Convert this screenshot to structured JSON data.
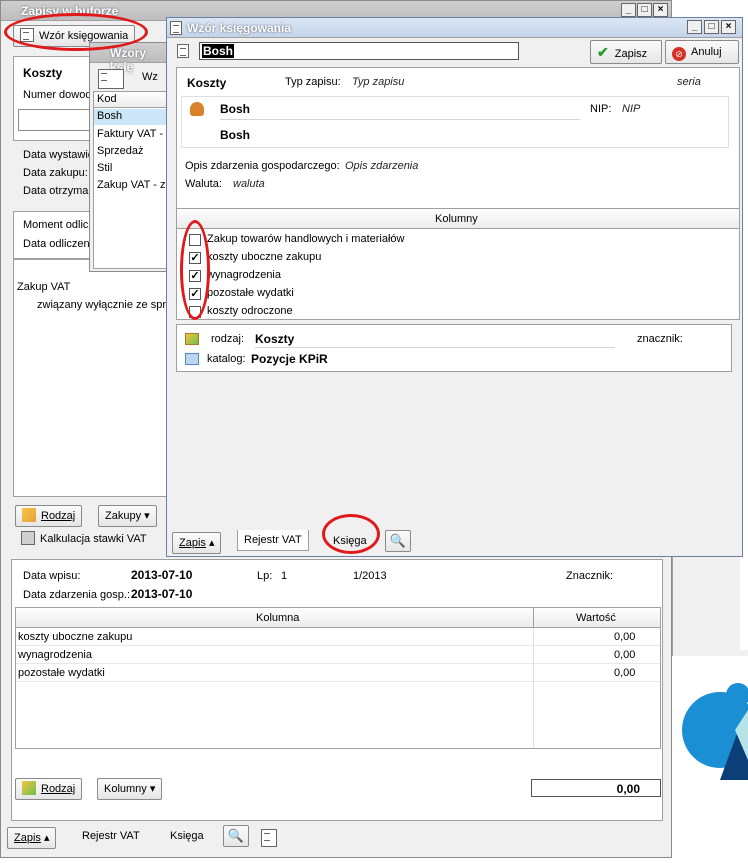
{
  "bg_window": {
    "title": "Zapisy w buforze",
    "tab_button": "Wzór księgowania",
    "label_koszty": "Koszty",
    "label_numer": "Numer dowod",
    "label_data_wystaw": "Data wystawie",
    "label_data_zakupu": "Data zakupu:",
    "label_data_otrzym": "Data otrzymar",
    "label_moment": "Moment odlicz",
    "label_data_odlicz": "Data odliczen",
    "zakup_vat": "Zakup VAT",
    "zwiazany": "związany wyłącznie ze spra",
    "btn_rodzaj": "Rodzaj",
    "btn_zakupy": "Zakupy",
    "btn_kalkulacja": "Kalkulacja stawki VAT",
    "label_data_wpisu": "Data wpisu:",
    "value_data_wpisu": "2013-07-10",
    "label_lp": "Lp:",
    "value_lp": "1",
    "value_lp_num": "1/2013",
    "label_znacznik": "Znacznik:",
    "label_data_zdarzenia": "Data zdarzenia gosp.:",
    "value_data_zdarzenia": "2013-07-10",
    "table_headers": [
      "Kolumna",
      "Wartość"
    ],
    "table_rows": [
      {
        "name": "koszty uboczne zakupu",
        "value": "0,00"
      },
      {
        "name": "wynagrodzenia",
        "value": "0,00"
      },
      {
        "name": "pozostałe wydatki",
        "value": "0,00"
      }
    ],
    "btn_rodzaj2": "Rodzaj",
    "btn_kolumny": "Kolumny",
    "total": "0,00",
    "tab_zapis": "Zapis",
    "tab_rejestr": "Rejestr VAT",
    "tab_ksiega": "Księga"
  },
  "wzory_window": {
    "title": "Wzory księ",
    "toolbar_label": "Wz",
    "col_kod": "Kod",
    "items": [
      "Bosh",
      "Faktury VAT -",
      "Sprzedaż",
      "Stil",
      "Zakup VAT - z"
    ]
  },
  "main_window": {
    "title": "Wzór księgowania",
    "name_value": "Bosh",
    "btn_zapisz": "Zapisz",
    "btn_anuluj": "Anuluj",
    "label_koszty": "Koszty",
    "label_typ_zapisu": "Typ zapisu:",
    "value_typ_zapisu": "Typ zapisu",
    "value_seria": "seria",
    "contractor_name1": "Bosh",
    "contractor_name2": "Bosh",
    "label_nip": "NIP:",
    "value_nip": "NIP",
    "label_opis": "Opis zdarzenia gospodarczego:",
    "value_opis": "Opis zdarzenia",
    "label_waluta": "Waluta:",
    "value_waluta": "waluta",
    "kolumny_header": "Kolumny",
    "checkboxes": [
      {
        "label": "Zakup towarów handlowych i materiałów",
        "checked": false
      },
      {
        "label": "koszty uboczne zakupu",
        "checked": true
      },
      {
        "label": "wynagrodzenia",
        "checked": true
      },
      {
        "label": "pozostałe wydatki",
        "checked": true
      },
      {
        "label": "koszty odroczone",
        "checked": false
      }
    ],
    "label_rodzaj": "rodzaj:",
    "value_rodzaj": "Koszty",
    "label_znacznik": "znacznik:",
    "label_katalog": "katalog:",
    "value_katalog": "Pozycje KPiR",
    "tab_zapis": "Zapis",
    "tab_rejestr": "Rejestr VAT",
    "tab_ksiega": "Księga"
  },
  "colors": {
    "annotation_red": "#e0191b",
    "selected_row": "#cde6f7",
    "titlebar_active": "#c4d4ea"
  }
}
